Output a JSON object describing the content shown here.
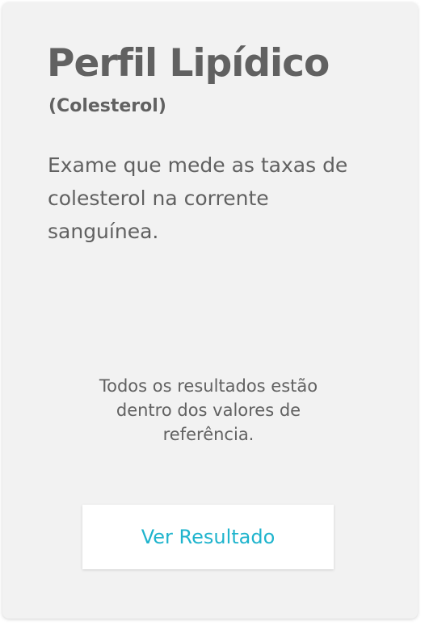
{
  "card": {
    "title": "Perfil Lipídico",
    "subtitle": "(Colesterol)",
    "description": "Exame que mede as taxas de colesterol na corrente sanguínea.",
    "status": "Todos os resultados estão dentro dos valores de referência.",
    "button_label": "Ver Resultado"
  },
  "colors": {
    "card_background": "#f2f2f2",
    "text": "#616161",
    "accent": "#1fb4cd",
    "button_background": "#ffffff"
  }
}
